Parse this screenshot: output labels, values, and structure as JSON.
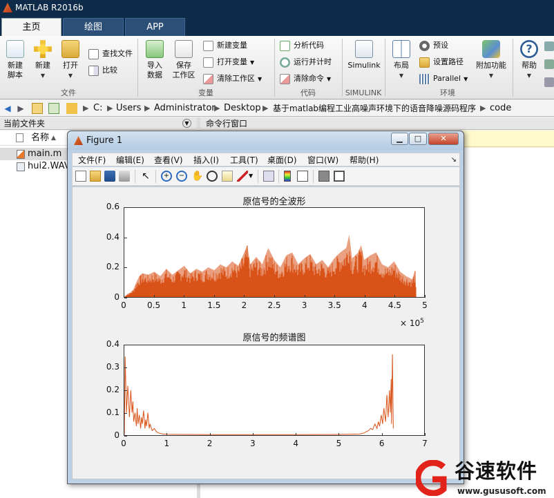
{
  "app": {
    "title": "MATLAB R2016b"
  },
  "ribbon_tabs": [
    {
      "label": "主页",
      "active": true
    },
    {
      "label": "绘图",
      "active": false
    },
    {
      "label": "APP",
      "active": false
    }
  ],
  "ribbon": {
    "new_script": "新建\n脚本",
    "new": "新建",
    "open": "打开",
    "find_files": "查找文件",
    "compare": "比较",
    "import_data": "导入\n数据",
    "save_workspace": "保存\n工作区",
    "new_variable": "新建变量",
    "open_variable": "打开变量",
    "clear_workspace": "清除工作区",
    "analyze_code": "分析代码",
    "run_and_time": "运行并计时",
    "clear_commands": "清除命令",
    "simulink": "Simulink",
    "layout": "布局",
    "preferences": "预设",
    "set_path": "设置路径",
    "parallel": "Parallel",
    "addons": "附加功能",
    "help": "帮助",
    "groups": {
      "file": "文件",
      "variable": "变量",
      "code": "代码",
      "simulink": "SIMULINK",
      "environment": "环境"
    }
  },
  "address": {
    "crumbs": [
      "C:",
      "Users",
      "Administrator",
      "Desktop",
      "基于matlab编程工业高噪声环境下的语音降噪源码程序",
      "code"
    ]
  },
  "current_folder": {
    "title": "当前文件夹",
    "column_name": "名称",
    "sort_indicator": "▲",
    "files": [
      "main.m",
      "hui2.WAV"
    ]
  },
  "command_window": {
    "title": "命令行窗口"
  },
  "figure": {
    "title": "Figure 1",
    "menu": [
      "文件(F)",
      "编辑(E)",
      "查看(V)",
      "插入(I)",
      "工具(T)",
      "桌面(D)",
      "窗口(W)",
      "帮助(H)"
    ],
    "toolbar_icons": [
      "new-figure-icon",
      "open-file-icon",
      "save-icon",
      "print-icon",
      "pointer-icon",
      "zoom-in-icon",
      "zoom-out-icon",
      "pan-icon",
      "rotate-3d-icon",
      "data-cursor-icon",
      "brush-icon",
      "link-plot-icon",
      "colorbar-icon",
      "legend-icon",
      "hide-plot-tools-icon",
      "show-plot-tools-icon"
    ]
  },
  "chart_data": [
    {
      "type": "area",
      "title": "原信号的全波形",
      "xlabel": "",
      "ylabel": "",
      "xlim": [
        0,
        500000
      ],
      "ylim": [
        0,
        0.6
      ],
      "xticks": [
        0,
        0.5,
        1,
        1.5,
        2,
        2.5,
        3,
        3.5,
        4,
        4.5,
        5
      ],
      "x_multiplier": "× 10",
      "x_exponent": "5",
      "yticks": [
        0,
        0.2,
        0.4,
        0.6
      ],
      "color": "#d95319",
      "envelope": [
        [
          0,
          0.0
        ],
        [
          5000,
          0.02
        ],
        [
          10000,
          0.03
        ],
        [
          15000,
          0.05
        ],
        [
          20000,
          0.1
        ],
        [
          25000,
          0.14
        ],
        [
          30000,
          0.16
        ],
        [
          40000,
          0.15
        ],
        [
          50000,
          0.17
        ],
        [
          60000,
          0.14
        ],
        [
          70000,
          0.19
        ],
        [
          80000,
          0.15
        ],
        [
          90000,
          0.18
        ],
        [
          100000,
          0.21
        ],
        [
          110000,
          0.16
        ],
        [
          120000,
          0.19
        ],
        [
          130000,
          0.17
        ],
        [
          140000,
          0.2
        ],
        [
          150000,
          0.18
        ],
        [
          160000,
          0.22
        ],
        [
          170000,
          0.2
        ],
        [
          180000,
          0.24
        ],
        [
          190000,
          0.21
        ],
        [
          200000,
          0.3
        ],
        [
          205000,
          0.35
        ],
        [
          210000,
          0.22
        ],
        [
          220000,
          0.27
        ],
        [
          230000,
          0.22
        ],
        [
          240000,
          0.33
        ],
        [
          250000,
          0.25
        ],
        [
          260000,
          0.2
        ],
        [
          270000,
          0.28
        ],
        [
          280000,
          0.3
        ],
        [
          290000,
          0.22
        ],
        [
          300000,
          0.26
        ],
        [
          310000,
          0.29
        ],
        [
          320000,
          0.22
        ],
        [
          330000,
          0.25
        ],
        [
          340000,
          0.2
        ],
        [
          350000,
          0.26
        ],
        [
          360000,
          0.3
        ],
        [
          370000,
          0.33
        ],
        [
          375000,
          0.42
        ],
        [
          380000,
          0.26
        ],
        [
          390000,
          0.3
        ],
        [
          395000,
          0.35
        ],
        [
          400000,
          0.25
        ],
        [
          410000,
          0.28
        ],
        [
          420000,
          0.3
        ],
        [
          430000,
          0.22
        ],
        [
          440000,
          0.2
        ],
        [
          450000,
          0.24
        ],
        [
          460000,
          0.17
        ],
        [
          470000,
          0.14
        ],
        [
          480000,
          0.12
        ],
        [
          485000,
          0.18
        ],
        [
          487000,
          0.0
        ]
      ]
    },
    {
      "type": "line",
      "title": "原信号的频谱图",
      "xlabel": "",
      "ylabel": "",
      "xlim": [
        0,
        7
      ],
      "ylim": [
        0,
        0.4
      ],
      "xticks": [
        0,
        1,
        2,
        3,
        4,
        5,
        6,
        7
      ],
      "yticks": [
        0,
        0.1,
        0.2,
        0.3,
        0.4
      ],
      "color": "#d95319",
      "series": [
        {
          "x": [
            0.0,
            0.02,
            0.05,
            0.08,
            0.12,
            0.15,
            0.18,
            0.2,
            0.22,
            0.25,
            0.28,
            0.3,
            0.32,
            0.35,
            0.38,
            0.4,
            0.42,
            0.45,
            0.48,
            0.5,
            0.52,
            0.55,
            0.58,
            0.6,
            0.65,
            0.7,
            0.75,
            0.8,
            0.9,
            1.0,
            1.5,
            2.0,
            3.0,
            4.0,
            5.0,
            5.5,
            5.6,
            5.65,
            5.7,
            5.75,
            5.8,
            5.85,
            5.9,
            5.93,
            5.96,
            6.0,
            6.03,
            6.06,
            6.1,
            6.13,
            6.16,
            6.19,
            6.21,
            6.23,
            6.24,
            6.26,
            6.28
          ],
          "y": [
            0.0,
            0.35,
            0.1,
            0.22,
            0.08,
            0.2,
            0.1,
            0.15,
            0.06,
            0.1,
            0.04,
            0.12,
            0.05,
            0.09,
            0.03,
            0.08,
            0.05,
            0.11,
            0.03,
            0.07,
            0.04,
            0.1,
            0.03,
            0.05,
            0.02,
            0.03,
            0.015,
            0.01,
            0.005,
            0.004,
            0.003,
            0.002,
            0.002,
            0.002,
            0.003,
            0.005,
            0.01,
            0.015,
            0.02,
            0.03,
            0.025,
            0.05,
            0.03,
            0.06,
            0.04,
            0.09,
            0.05,
            0.12,
            0.06,
            0.18,
            0.08,
            0.2,
            0.1,
            0.25,
            0.05,
            0.36,
            0.03
          ]
        }
      ]
    }
  ],
  "watermark": {
    "name": "谷速软件",
    "url": "www.gususoft.com"
  }
}
